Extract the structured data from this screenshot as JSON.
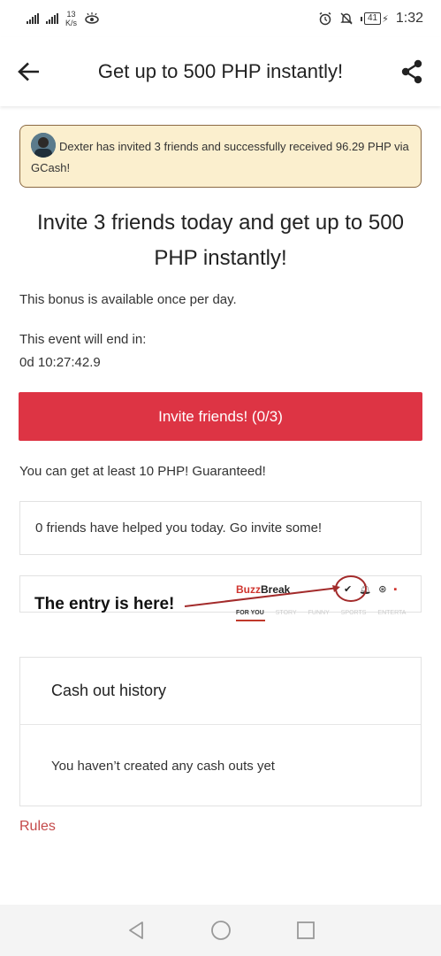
{
  "status_bar": {
    "network_speed_value": "13",
    "network_speed_unit": "K/s",
    "battery": "41",
    "time": "1:32"
  },
  "header": {
    "title": "Get up to 500 PHP instantly!"
  },
  "notice": {
    "text": "Dexter has invited 3 friends and successfully received 96.29 PHP via GCash!"
  },
  "headline": "Invite 3 friends today and get up to 500 PHP instantly!",
  "bonus_note": "This bonus is available once per day.",
  "event_end_label": "This event will end in:",
  "countdown": "0d 10:27:42.9",
  "invite_button": "Invite friends! (0/3)",
  "guarantee_text": "You can get at least 10 PHP! Guaranteed!",
  "helped_text": "0 friends have helped you today. Go invite some!",
  "entry_hint": {
    "text": "The entry is here!",
    "app_logo_part1": "Buzz",
    "app_logo_part2": "Break",
    "tabs": [
      "FOR YOU",
      "STORY",
      "FUNNY",
      "SPORTS",
      "ENTERTA"
    ]
  },
  "cashout": {
    "title": "Cash out history",
    "empty_text": "You haven’t created any cash outs yet"
  },
  "rules_link": "Rules",
  "colors": {
    "primary_red": "#dd3444",
    "notice_bg": "#fbefce",
    "notice_border": "#8b6a44",
    "link_red": "#c44a4a"
  }
}
